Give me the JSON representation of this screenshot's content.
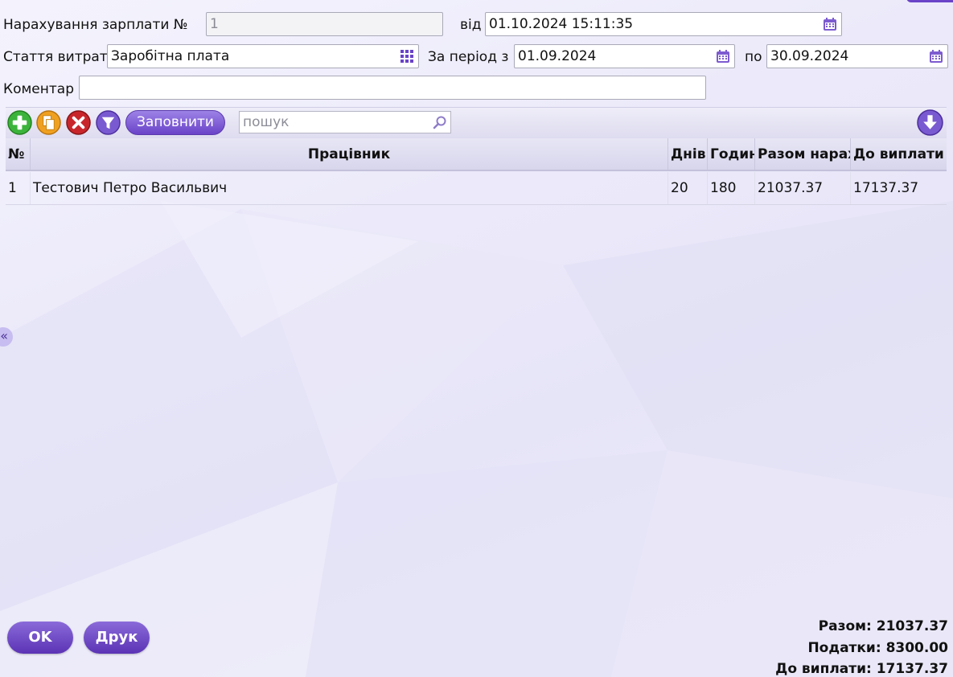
{
  "header": {
    "doc_label": "Нарахування зарплати №",
    "doc_number": "1",
    "date_label": "від",
    "date_value": "01.10.2024 15:11:35",
    "expense_label": "Стаття витрат",
    "expense_value": "Заробітна плата",
    "period_label": "За період з",
    "period_from": "01.09.2024",
    "period_to_label": "по",
    "period_to": "30.09.2024",
    "comment_label": "Коментар",
    "comment_value": ""
  },
  "toolbar": {
    "icons": [
      "add-icon",
      "copy-icon",
      "delete-icon",
      "filter-icon",
      "download-icon"
    ],
    "fill_label": "Заповнити",
    "search_placeholder": "пошук"
  },
  "table": {
    "columns": [
      "№",
      "Працівник",
      "Днів",
      "Годин",
      "Разом нарах",
      "До виплати"
    ],
    "rows": [
      [
        "1",
        "Тестович Петро Васильвич",
        "20",
        "180",
        "21037.37",
        "17137.37"
      ]
    ]
  },
  "side_toggle": "«",
  "footer": {
    "ok_label": "OK",
    "print_label": "Друк",
    "total": "Разом: 21037.37",
    "taxes": "Податки: 8300.00",
    "payout": "До виплати: 17137.37"
  },
  "colors": {
    "accent": "#6a43c8",
    "add": "#3cb43c",
    "copy": "#f0a020",
    "delete": "#c8262b",
    "filter": "#7a5ad0"
  }
}
